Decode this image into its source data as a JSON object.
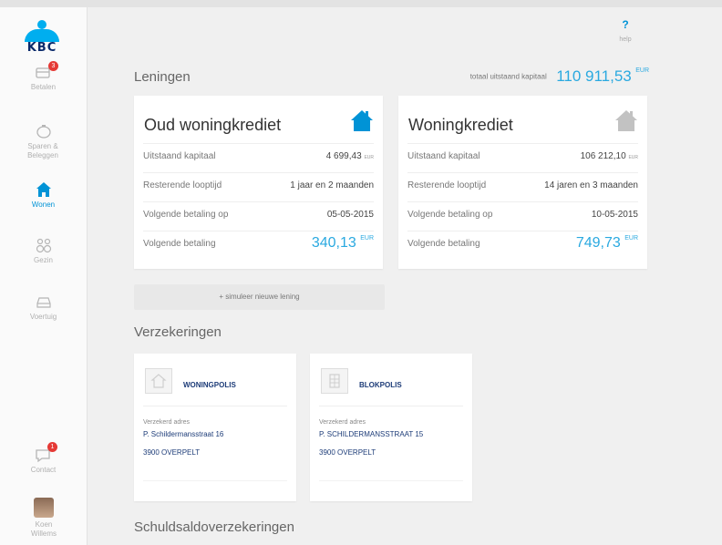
{
  "brand": {
    "name": "KBC",
    "color": "#0b2a6b",
    "accent": "#00aeef"
  },
  "sidebar": {
    "items": [
      {
        "label": "Betalen",
        "icon": "payment-icon",
        "badge": "3"
      },
      {
        "label": "Sparen & Beleggen",
        "icon": "piggy-bank-icon"
      },
      {
        "label": "Wonen",
        "icon": "home-icon",
        "active": true
      },
      {
        "label": "Gezin",
        "icon": "family-icon"
      },
      {
        "label": "Voertuig",
        "icon": "car-icon"
      }
    ],
    "contact": {
      "label": "Contact",
      "icon": "chat-icon",
      "badge": "1"
    },
    "user": {
      "label": "Koen Willems",
      "icon": "avatar"
    }
  },
  "help": {
    "symbol": "?",
    "label": "help"
  },
  "loans": {
    "title": "Leningen",
    "total_label": "totaal uitstaand kapitaal",
    "total_value": "110 911,53",
    "total_currency": "EUR",
    "cards": [
      {
        "title": "Oud woningkrediet",
        "icon": "house-icon",
        "rows": [
          {
            "label": "Uitstaand kapitaal",
            "value": "4 699,43",
            "currency": "EUR"
          },
          {
            "label": "Resterende looptijd",
            "value": "1 jaar en 2 maanden"
          },
          {
            "label": "Volgende betaling op",
            "value": "05-05-2015"
          },
          {
            "label": "Volgende betaling",
            "value": "340,13",
            "currency": "EUR"
          }
        ]
      },
      {
        "title": "Woningkrediet",
        "icon": "house-icon",
        "rows": [
          {
            "label": "Uitstaand kapitaal",
            "value": "106 212,10",
            "currency": "EUR"
          },
          {
            "label": "Resterende looptijd",
            "value": "14 jaren en 3 maanden"
          },
          {
            "label": "Volgende betaling op",
            "value": "10-05-2015"
          },
          {
            "label": "Volgende betaling",
            "value": "749,73",
            "currency": "EUR"
          }
        ]
      }
    ],
    "simulate_label": "+ simuleer nieuwe lening"
  },
  "insurance": {
    "title": "Verzekeringen",
    "policies": [
      {
        "name": "WONINGPOLIS",
        "icon": "house-outline-icon",
        "address_label": "Verzekerd adres",
        "street": "P. Schildermansstraat 16",
        "city": "3900 OVERPELT"
      },
      {
        "name": "BLOKPOLIS",
        "icon": "building-icon",
        "address_label": "Verzekerd adres",
        "street": "P. SCHILDERMANSSTRAAT 15",
        "city": "3900 OVERPELT"
      }
    ]
  },
  "debt_insurance": {
    "title": "Schuldsaldoverzekeringen"
  },
  "colors": {
    "accent_blue": "#2aa9e0",
    "badge_red": "#e53935",
    "dark_blue": "#1d3c78"
  }
}
